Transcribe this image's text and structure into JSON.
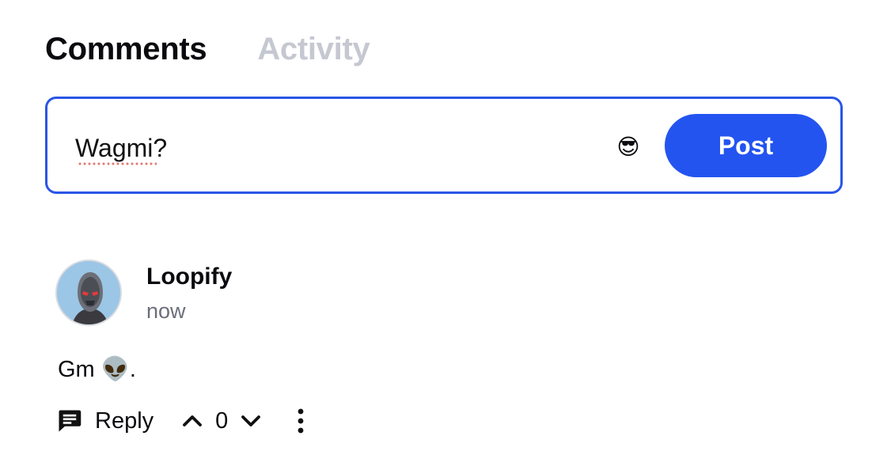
{
  "tabs": [
    {
      "label": "Comments",
      "active": true
    },
    {
      "label": "Activity",
      "active": false
    }
  ],
  "composer": {
    "value": "Wagmi?",
    "emoji": "😎",
    "post_label": "Post",
    "accent": "#2454f0"
  },
  "comment": {
    "author": "Loopify",
    "time": "now",
    "text": "Gm 👽.",
    "reply_label": "Reply",
    "vote_count": "0"
  },
  "icons": {
    "emoji_picker": "sunglasses-emoji-icon",
    "reply": "comment-bubble-icon",
    "upvote": "chevron-up-icon",
    "downvote": "chevron-down-icon",
    "more": "more-vertical-icon"
  }
}
